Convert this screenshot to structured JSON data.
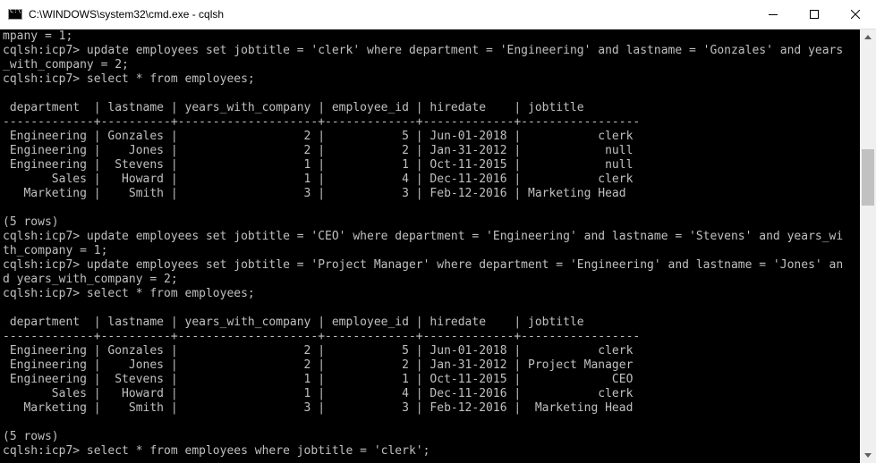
{
  "window": {
    "title": "C:\\WINDOWS\\system32\\cmd.exe - cqlsh",
    "icons": {
      "app": "console-icon",
      "minimize": "minimize-icon",
      "maximize": "maximize-icon",
      "close": "close-icon"
    }
  },
  "console": {
    "text": "mpany = 1;\ncqlsh:icp7> update employees set jobtitle = 'clerk' where department = 'Engineering' and lastname = 'Gonzales' and years\n_with_company = 2;\ncqlsh:icp7> select * from employees;\n\n department  | lastname | years_with_company | employee_id | hiredate    | jobtitle\n-------------+----------+--------------------+-------------+-------------+-----------------\n Engineering | Gonzales |                  2 |           5 | Jun-01-2018 |           clerk\n Engineering |    Jones |                  2 |           2 | Jan-31-2012 |            null\n Engineering |  Stevens |                  1 |           1 | Oct-11-2015 |            null\n       Sales |   Howard |                  1 |           4 | Dec-11-2016 |           clerk\n   Marketing |    Smith |                  3 |           3 | Feb-12-2016 | Marketing Head\n\n(5 rows)\ncqlsh:icp7> update employees set jobtitle = 'CEO' where department = 'Engineering' and lastname = 'Stevens' and years_wi\nth_company = 1;\ncqlsh:icp7> update employees set jobtitle = 'Project Manager' where department = 'Engineering' and lastname = 'Jones' an\nd years_with_company = 2;\ncqlsh:icp7> select * from employees;\n\n department  | lastname | years_with_company | employee_id | hiredate    | jobtitle\n-------------+----------+--------------------+-------------+-------------+-----------------\n Engineering | Gonzales |                  2 |           5 | Jun-01-2018 |           clerk\n Engineering |    Jones |                  2 |           2 | Jan-31-2012 | Project Manager\n Engineering |  Stevens |                  1 |           1 | Oct-11-2015 |             CEO\n       Sales |   Howard |                  1 |           4 | Dec-11-2016 |           clerk\n   Marketing |    Smith |                  3 |           3 | Feb-12-2016 |  Marketing Head\n\n(5 rows)\ncqlsh:icp7> select * from employees where jobtitle = 'clerk';"
  },
  "scrollbar": {
    "icons": {
      "up": "scroll-up-arrow-icon",
      "down": "scroll-down-arrow-icon"
    },
    "thumb_position_fraction": 0.26,
    "thumb_size_fraction": 0.14
  },
  "colors": {
    "console_background": "#000000",
    "console_text": "#c0c0c0",
    "titlebar_background": "#ffffff"
  }
}
